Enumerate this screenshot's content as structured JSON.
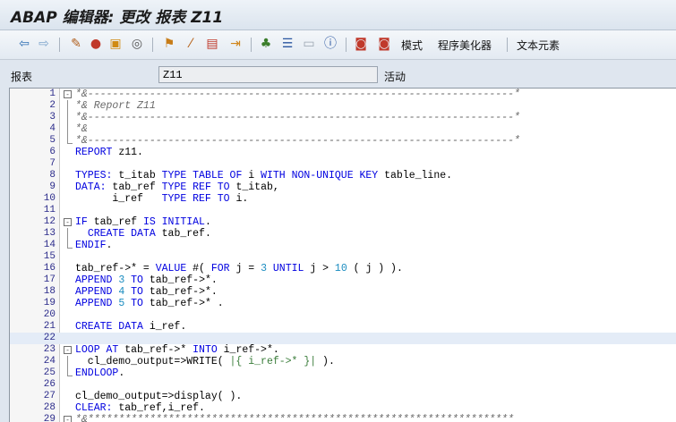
{
  "window": {
    "title": "ABAP 编辑器: 更改 报表 Z11"
  },
  "toolbar": {
    "mode_label": "模式",
    "pretty_printer_label": "程序美化器",
    "text_elements_label": "文本元素"
  },
  "form": {
    "program_label": "报表",
    "program_value": "Z11",
    "status_label": "活动"
  },
  "editor": {
    "lines": [
      {
        "n": "1",
        "fold": "box",
        "html": "<span class=\"cm\">*&amp;---------------------------------------------------------------------*</span>"
      },
      {
        "n": "2",
        "fold": "line",
        "html": "<span class=\"cm\">*&amp; Report Z11</span>"
      },
      {
        "n": "3",
        "fold": "line",
        "html": "<span class=\"cm\">*&amp;---------------------------------------------------------------------*</span>"
      },
      {
        "n": "4",
        "fold": "line",
        "html": "<span class=\"cm\">*&amp;</span>"
      },
      {
        "n": "5",
        "fold": "end",
        "html": "<span class=\"cm\">*&amp;---------------------------------------------------------------------*</span>"
      },
      {
        "n": "6",
        "fold": "",
        "html": "<span class=\"kw\">REPORT</span> z11."
      },
      {
        "n": "7",
        "fold": "",
        "html": ""
      },
      {
        "n": "8",
        "fold": "",
        "html": "<span class=\"kw\">TYPES:</span> t_itab <span class=\"kw\">TYPE TABLE OF</span> i <span class=\"kw\">WITH NON-UNIQUE KEY</span> table_line."
      },
      {
        "n": "9",
        "fold": "",
        "html": "<span class=\"kw\">DATA:</span> tab_ref <span class=\"kw\">TYPE REF TO</span> t_itab,"
      },
      {
        "n": "10",
        "fold": "",
        "html": "      i_ref   <span class=\"kw\">TYPE REF TO</span> i."
      },
      {
        "n": "11",
        "fold": "",
        "html": ""
      },
      {
        "n": "12",
        "fold": "box",
        "html": "<span class=\"kw\">IF</span> tab_ref <span class=\"kw\">IS INITIAL</span>."
      },
      {
        "n": "13",
        "fold": "line",
        "html": "  <span class=\"kw\">CREATE DATA</span> tab_ref."
      },
      {
        "n": "14",
        "fold": "end",
        "html": "<span class=\"kw\">ENDIF</span>."
      },
      {
        "n": "15",
        "fold": "",
        "html": ""
      },
      {
        "n": "16",
        "fold": "",
        "html": "tab_ref-&gt;* = <span class=\"kw\">VALUE</span> #( <span class=\"kw\">FOR</span> j = <span class=\"num-lit\">3</span> <span class=\"kw\">UNTIL</span> j &gt; <span class=\"num-lit\">10</span> ( j ) )."
      },
      {
        "n": "17",
        "fold": "",
        "html": "<span class=\"kw\">APPEND</span> <span class=\"num-lit\">3</span> <span class=\"kw\">TO</span> tab_ref-&gt;*."
      },
      {
        "n": "18",
        "fold": "",
        "html": "<span class=\"kw\">APPEND</span> <span class=\"num-lit\">4</span> <span class=\"kw\">TO</span> tab_ref-&gt;*."
      },
      {
        "n": "19",
        "fold": "",
        "html": "<span class=\"kw\">APPEND</span> <span class=\"num-lit\">5</span> <span class=\"kw\">TO</span> tab_ref-&gt;* ."
      },
      {
        "n": "20",
        "fold": "",
        "html": ""
      },
      {
        "n": "21",
        "fold": "",
        "html": "<span class=\"kw\">CREATE DATA</span> i_ref."
      },
      {
        "n": "22",
        "fold": "",
        "active": true,
        "html": ""
      },
      {
        "n": "23",
        "fold": "box",
        "html": "<span class=\"kw\">LOOP AT</span> tab_ref-&gt;* <span class=\"kw\">INTO</span> i_ref-&gt;*."
      },
      {
        "n": "24",
        "fold": "line",
        "html": "  cl_demo_output=&gt;WRITE( <span class=\"str\">|{ i_ref-&gt;* }|</span> )."
      },
      {
        "n": "25",
        "fold": "end",
        "html": "<span class=\"kw\">ENDLOOP</span>."
      },
      {
        "n": "26",
        "fold": "",
        "html": ""
      },
      {
        "n": "27",
        "fold": "",
        "html": "cl_demo_output=&gt;display( )."
      },
      {
        "n": "28",
        "fold": "",
        "html": "<span class=\"kw\">CLEAR:</span> tab_ref,i_ref."
      },
      {
        "n": "29",
        "fold": "box",
        "html": "<span class=\"cm\">*&amp;*********************************************************************</span>"
      }
    ]
  },
  "colors": {
    "keyword": "#0000e0",
    "comment": "#6a6a6a",
    "number": "#1a8cc0",
    "active_line": "#e4ecf7"
  }
}
